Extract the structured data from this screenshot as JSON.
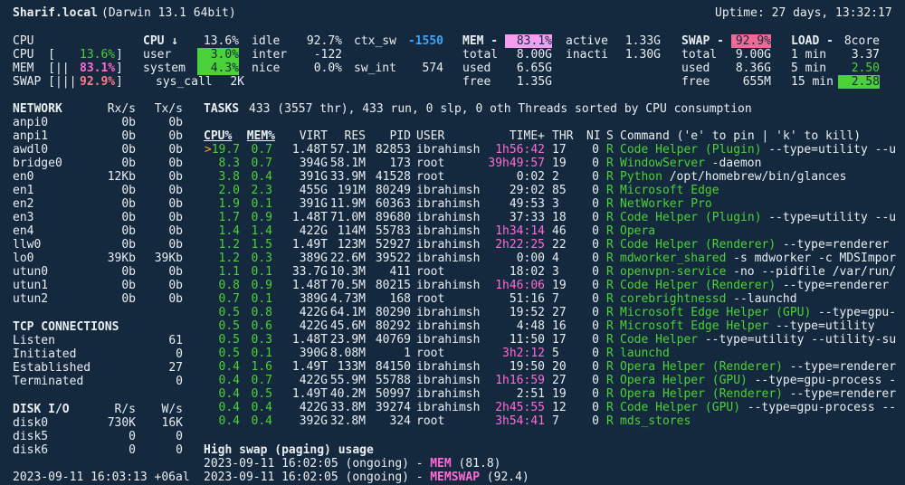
{
  "header": {
    "host": "Sharif.local",
    "os": "(Darwin 13.1 64bit)",
    "uptime": "Uptime: 27 days, 13:32:17"
  },
  "quicklook": {
    "cpu_label": "CPU",
    "cpu_bar": "CPU  [",
    "cpu_pct": "13.6%",
    "mem_bar": "MEM  [||",
    "mem_pct": "83.1%",
    "swap_bar": "SWAP [|||",
    "swap_pct": "92.9%",
    "close": "]"
  },
  "cpu": {
    "title": "CPU ↓",
    "total": "13.6%",
    "user_label": "user",
    "user": "3.0%",
    "system_label": "system",
    "system": "4.3%",
    "syscall_label": "sys_call",
    "syscall": "2K",
    "idle_label": "idle",
    "idle": "92.7%",
    "inter_label": "inter",
    "inter": "-122",
    "nice_label": "nice",
    "nice": "0.0%",
    "ctx_label": "ctx_sw",
    "ctx": "-1550",
    "swint_label": "sw_int",
    "swint": "574"
  },
  "mem": {
    "title": "MEM -",
    "pct": "83.1%",
    "total_label": "total",
    "total": "8.00G",
    "used_label": "used",
    "used": "6.65G",
    "free_label": "free",
    "free": "1.35G",
    "active_label": "active",
    "active": "1.33G",
    "inact_label": "inacti",
    "inact": "1.30G"
  },
  "swap": {
    "title": "SWAP -",
    "pct": "92.9%",
    "total_label": "total",
    "total": "9.00G",
    "used_label": "used",
    "used": "8.36G",
    "free_label": "free",
    "free": "655M"
  },
  "load": {
    "title": "LOAD -",
    "cores": "8core",
    "l1_label": "1 min",
    "l1": "3.37",
    "l5_label": "5 min",
    "l5": "2.50",
    "l15_label": "15 min",
    "l15": "2.58"
  },
  "network": {
    "title": "NETWORK",
    "rx_h": "Rx/s",
    "tx_h": "Tx/s",
    "rows": [
      [
        "anpi0",
        "0b",
        "0b"
      ],
      [
        "anpi1",
        "0b",
        "0b"
      ],
      [
        "awdl0",
        "0b",
        "0b"
      ],
      [
        "bridge0",
        "0b",
        "0b"
      ],
      [
        "en0",
        "12Kb",
        "0b"
      ],
      [
        "en1",
        "0b",
        "0b"
      ],
      [
        "en2",
        "0b",
        "0b"
      ],
      [
        "en3",
        "0b",
        "0b"
      ],
      [
        "en4",
        "0b",
        "0b"
      ],
      [
        "llw0",
        "0b",
        "0b"
      ],
      [
        "lo0",
        "39Kb",
        "39Kb"
      ],
      [
        "utun0",
        "0b",
        "0b"
      ],
      [
        "utun1",
        "0b",
        "0b"
      ],
      [
        "utun2",
        "0b",
        "0b"
      ]
    ]
  },
  "tcp": {
    "title": "TCP CONNECTIONS",
    "rows": [
      [
        "Listen",
        "61"
      ],
      [
        "Initiated",
        "0"
      ],
      [
        "Established",
        "27"
      ],
      [
        "Terminated",
        "0"
      ]
    ]
  },
  "disk": {
    "title": "DISK I/O",
    "r_h": "R/s",
    "w_h": "W/s",
    "rows": [
      [
        "disk0",
        "730K",
        "16K"
      ],
      [
        "disk5",
        "0",
        "0"
      ],
      [
        "disk6",
        "0",
        "0"
      ]
    ]
  },
  "datetime": "2023-09-11 16:03:13 +06al",
  "tasks": {
    "label": "TASKS",
    "summary": "433 (3557 thr), 433 run, 0 slp, 0 oth Threads sorted by CPU consumption"
  },
  "proc": {
    "headers": [
      "CPU%",
      "MEM%",
      "VIRT",
      "RES",
      "PID",
      "USER",
      "TIME+",
      "THR",
      "NI",
      "S",
      "Command ('e' to pin | 'k' to kill)"
    ],
    "rows": [
      [
        ">19.7",
        "0.7",
        "1.48T",
        "57.1M",
        "82853",
        "ibrahimsh",
        "1h56:42",
        "17",
        "0",
        "R",
        "Code Helper (Plugin)",
        " --type=utility --u"
      ],
      [
        "8.3",
        "0.7",
        "394G",
        "58.1M",
        "173",
        "root",
        "39h49:57",
        "19",
        "0",
        "R",
        "WindowServer",
        " -daemon"
      ],
      [
        "3.8",
        "0.4",
        "391G",
        "33.9M",
        "41528",
        "root",
        "0:02",
        "2",
        "0",
        "R",
        "Python",
        " /opt/homebrew/bin/glances"
      ],
      [
        "2.0",
        "2.3",
        "455G",
        "191M",
        "80249",
        "ibrahimsh",
        "29:02",
        "85",
        "0",
        "R",
        "Microsoft Edge",
        ""
      ],
      [
        "1.9",
        "0.1",
        "391G",
        "11.9M",
        "60363",
        "ibrahimsh",
        "49:53",
        "3",
        "0",
        "R",
        "NetWorker Pro",
        ""
      ],
      [
        "1.7",
        "0.9",
        "1.48T",
        "71.0M",
        "89680",
        "ibrahimsh",
        "37:33",
        "18",
        "0",
        "R",
        "Code Helper (Plugin)",
        " --type=utility --u"
      ],
      [
        "1.4",
        "1.4",
        "422G",
        "114M",
        "55783",
        "ibrahimsh",
        "1h34:14",
        "46",
        "0",
        "R",
        "Opera",
        ""
      ],
      [
        "1.2",
        "1.5",
        "1.49T",
        "123M",
        "52927",
        "ibrahimsh",
        "2h22:25",
        "22",
        "0",
        "R",
        "Code Helper (Renderer)",
        " --type=renderer"
      ],
      [
        "1.2",
        "0.3",
        "389G",
        "22.6M",
        "39522",
        "ibrahimsh",
        "0:00",
        "4",
        "0",
        "R",
        "mdworker_shared",
        " -s mdworker -c MDSImpor"
      ],
      [
        "1.1",
        "0.1",
        "33.7G",
        "10.3M",
        "411",
        "root",
        "18:02",
        "3",
        "0",
        "R",
        "openvpn-service",
        " -no --pidfile /var/run/"
      ],
      [
        "0.8",
        "0.9",
        "1.48T",
        "70.5M",
        "80215",
        "ibrahimsh",
        "1h46:06",
        "19",
        "0",
        "R",
        "Code Helper (Renderer)",
        " --type=renderer"
      ],
      [
        "0.7",
        "0.1",
        "389G",
        "4.73M",
        "168",
        "root",
        "51:16",
        "7",
        "0",
        "R",
        "corebrightnessd",
        " --launchd"
      ],
      [
        "0.5",
        "0.8",
        "422G",
        "64.1M",
        "80290",
        "ibrahimsh",
        "19:52",
        "27",
        "0",
        "R",
        "Microsoft Edge Helper (GPU)",
        " --type=gpu-"
      ],
      [
        "0.5",
        "0.6",
        "422G",
        "45.6M",
        "80292",
        "ibrahimsh",
        "4:48",
        "16",
        "0",
        "R",
        "Microsoft Edge Helper",
        " --type=utility"
      ],
      [
        "0.5",
        "0.3",
        "1.48T",
        "23.9M",
        "40769",
        "ibrahimsh",
        "11:50",
        "17",
        "0",
        "R",
        "Code Helper",
        " --type=utility --utility-su"
      ],
      [
        "0.5",
        "0.1",
        "390G",
        "8.08M",
        "1",
        "root",
        "3h2:12",
        "5",
        "0",
        "R",
        "launchd",
        ""
      ],
      [
        "0.4",
        "1.6",
        "1.49T",
        "133M",
        "84150",
        "ibrahimsh",
        "19:50",
        "20",
        "0",
        "R",
        "Opera Helper (Renderer)",
        " --type=renderer"
      ],
      [
        "0.4",
        "0.7",
        "422G",
        "55.9M",
        "55788",
        "ibrahimsh",
        "1h16:59",
        "27",
        "0",
        "R",
        "Opera Helper (GPU)",
        " --type=gpu-process -"
      ],
      [
        "0.4",
        "0.5",
        "1.49T",
        "40.2M",
        "50997",
        "ibrahimsh",
        "2:51",
        "19",
        "0",
        "R",
        "Opera Helper (Renderer)",
        " --type=renderer"
      ],
      [
        "0.4",
        "0.4",
        "422G",
        "33.8M",
        "39274",
        "ibrahimsh",
        "2h45:55",
        "12",
        "0",
        "R",
        "Code Helper (GPU)",
        " --type=gpu-process --"
      ],
      [
        "0.4",
        "0.4",
        "392G",
        "32.8M",
        "324",
        "root",
        "3h54:41",
        "7",
        "0",
        "R",
        "mds_stores",
        ""
      ]
    ]
  },
  "alerts": {
    "title": "High swap (paging) usage",
    "rows": [
      [
        "2023-09-11 16:02:05 (ongoing) - ",
        "MEM",
        " (81.8)"
      ],
      [
        "2023-09-11 16:02:05 (ongoing) - ",
        "MEMSWAP",
        " (92.4)"
      ]
    ]
  },
  "colors": {
    "background": "#14293d",
    "green": "#4cd137",
    "magenta": "#ff6ad5",
    "blue": "#3aa6ff"
  }
}
